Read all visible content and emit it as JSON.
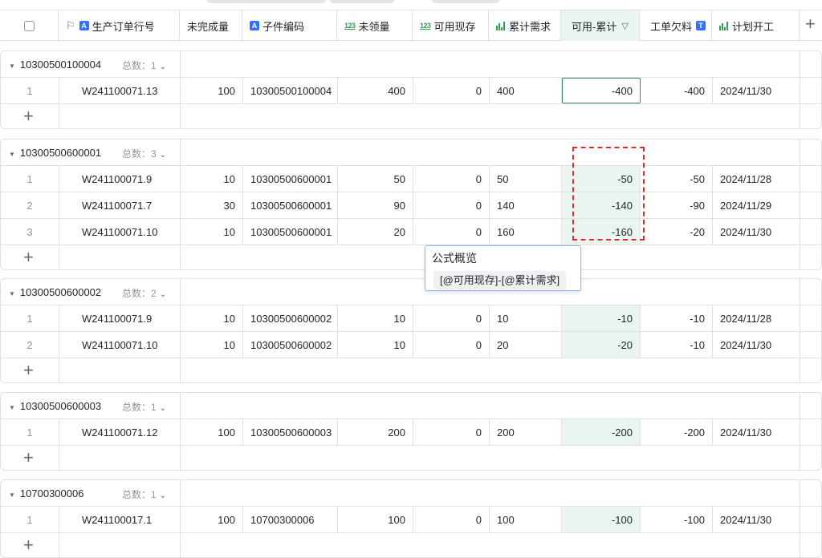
{
  "header": {
    "columns": [
      {
        "label": "",
        "icon": "checkbox"
      },
      {
        "label": "生产订单行号",
        "icon": "text-a-icon"
      },
      {
        "label": "未完成量",
        "icon": ""
      },
      {
        "label": "子件编码",
        "icon": "text-a-icon"
      },
      {
        "label": "未领量",
        "icon": "number-icon"
      },
      {
        "label": "可用现存",
        "icon": "number-icon"
      },
      {
        "label": "累计需求",
        "icon": "bar-chart-icon"
      },
      {
        "label": "可用-累计",
        "icon": "filter-icon"
      },
      {
        "label": "工单欠料",
        "icon": "text-t-icon"
      },
      {
        "label": "计划开工",
        "icon": "bar-chart-icon"
      }
    ],
    "num_icon_text": "123",
    "a_icon_text": "A",
    "t_icon_text": "T",
    "add_column": "+"
  },
  "groups": [
    {
      "title": "10300500100004",
      "count_label": "总数：",
      "count": "1",
      "rows": [
        {
          "idx": "1",
          "order": "W241100071.13",
          "unfinished": "100",
          "part": "10300500100004",
          "unclaimed": "400",
          "available": "0",
          "cumulative": "400",
          "diff": "-400",
          "shortage": "-400",
          "start": "2024/11/30"
        }
      ]
    },
    {
      "title": "10300500600001",
      "count_label": "总数：",
      "count": "3",
      "rows": [
        {
          "idx": "1",
          "order": "W241100071.9",
          "unfinished": "10",
          "part": "10300500600001",
          "unclaimed": "50",
          "available": "0",
          "cumulative": "50",
          "diff": "-50",
          "shortage": "-50",
          "start": "2024/11/28"
        },
        {
          "idx": "2",
          "order": "W241100071.7",
          "unfinished": "30",
          "part": "10300500600001",
          "unclaimed": "90",
          "available": "0",
          "cumulative": "140",
          "diff": "-140",
          "shortage": "-90",
          "start": "2024/11/29"
        },
        {
          "idx": "3",
          "order": "W241100071.10",
          "unfinished": "10",
          "part": "10300500600001",
          "unclaimed": "20",
          "available": "0",
          "cumulative": "160",
          "diff": "-160",
          "shortage": "-20",
          "start": "2024/11/30"
        }
      ]
    },
    {
      "title": "10300500600002",
      "count_label": "总数：",
      "count": "2",
      "rows": [
        {
          "idx": "1",
          "order": "W241100071.9",
          "unfinished": "10",
          "part": "10300500600002",
          "unclaimed": "10",
          "available": "0",
          "cumulative": "10",
          "diff": "-10",
          "shortage": "-10",
          "start": "2024/11/28"
        },
        {
          "idx": "2",
          "order": "W241100071.10",
          "unfinished": "10",
          "part": "10300500600002",
          "unclaimed": "10",
          "available": "0",
          "cumulative": "20",
          "diff": "-20",
          "shortage": "-10",
          "start": "2024/11/30"
        }
      ]
    },
    {
      "title": "10300500600003",
      "count_label": "总数：",
      "count": "1",
      "rows": [
        {
          "idx": "1",
          "order": "W241100071.12",
          "unfinished": "100",
          "part": "10300500600003",
          "unclaimed": "200",
          "available": "0",
          "cumulative": "200",
          "diff": "-200",
          "shortage": "-200",
          "start": "2024/11/30"
        }
      ]
    },
    {
      "title": "10700300006",
      "count_label": "总数：",
      "count": "1",
      "rows": [
        {
          "idx": "1",
          "order": "W241100017.1",
          "unfinished": "100",
          "part": "10700300006",
          "unclaimed": "100",
          "available": "0",
          "cumulative": "100",
          "diff": "-100",
          "shortage": "-100",
          "start": "2024/11/30"
        }
      ]
    }
  ],
  "add_row": "+",
  "tooltip": {
    "title": "公式概览",
    "formula": "[@可用现存]-[@累计需求]"
  },
  "colors": {
    "highlight_column": "#eaf5ef",
    "accent_blue": "#3370ff",
    "number_green": "#2aa352",
    "dashed_red": "#e02b2b",
    "selected_border": "#3c8c6a"
  }
}
